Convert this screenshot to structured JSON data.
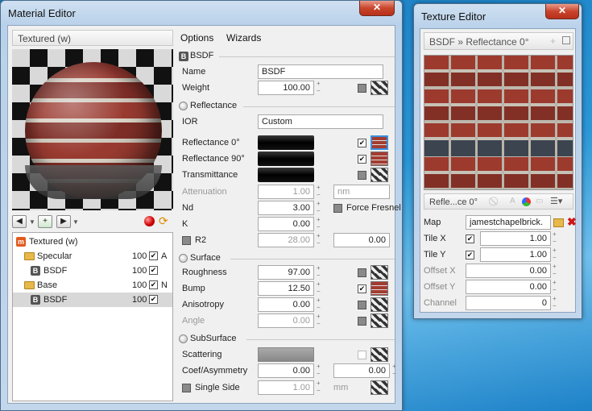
{
  "material_editor": {
    "title": "Material Editor",
    "close": "✕",
    "preview_title": "Textured (w)",
    "menu": [
      "Options",
      "Wizards"
    ],
    "tree": [
      {
        "name": "Textured (w)",
        "icon": "m",
        "num": "",
        "letter": "",
        "level": 0
      },
      {
        "name": "Specular",
        "icon": "folder",
        "num": "100",
        "letter": "A",
        "level": 1
      },
      {
        "name": "BSDF",
        "icon": "b",
        "num": "100",
        "letter": "",
        "level": 2
      },
      {
        "name": "Base",
        "icon": "folder",
        "num": "100",
        "letter": "N",
        "level": 1
      },
      {
        "name": "BSDF",
        "icon": "b",
        "num": "100",
        "letter": "",
        "level": 2
      }
    ],
    "sections": {
      "bsdf": "BSDF",
      "reflectance": "Reflectance",
      "surface": "Surface",
      "subsurface": "SubSurface"
    },
    "fields": {
      "name_label": "Name",
      "name_value": "BSDF",
      "weight_label": "Weight",
      "weight_value": "100.00",
      "ior_label": "IOR",
      "ior_value": "Custom",
      "refl0_label": "Reflectance 0°",
      "refl90_label": "Reflectance 90°",
      "trans_label": "Transmittance",
      "atten_label": "Attenuation",
      "atten_value": "1.00",
      "atten_unit": "nm",
      "nd_label": "Nd",
      "nd_value": "3.00",
      "fresnel_label": "Force Fresnel",
      "k_label": "K",
      "k_value": "0.00",
      "r2_label": "R2",
      "r2_value": "28.00",
      "r2_value2": "0.00",
      "rough_label": "Roughness",
      "rough_value": "97.00",
      "bump_label": "Bump",
      "bump_value": "12.50",
      "aniso_label": "Anisotropy",
      "aniso_value": "0.00",
      "angle_label": "Angle",
      "angle_value": "0.00",
      "scatter_label": "Scattering",
      "coef_label": "Coef/Asymmetry",
      "coef_value": "0.00",
      "coef_value2": "0.00",
      "single_label": "Single Side",
      "single_value": "1.00",
      "single_unit": "mm"
    }
  },
  "texture_editor": {
    "title": "Texture Editor",
    "close": "✕",
    "path": "BSDF » Reflectance 0°",
    "bar_label": "Refle...ce 0°",
    "map_label": "Map",
    "map_value": "jamestchapelbrick.",
    "tilex_label": "Tile X",
    "tilex_value": "1.00",
    "tiley_label": "Tile Y",
    "tiley_value": "1.00",
    "offx_label": "Offset X",
    "offx_value": "0.00",
    "offy_label": "Offset Y",
    "offy_value": "0.00",
    "channel_label": "Channel",
    "channel_value": "0"
  },
  "colors": {
    "accent": "#3c8fe0",
    "close": "#c8452c"
  }
}
